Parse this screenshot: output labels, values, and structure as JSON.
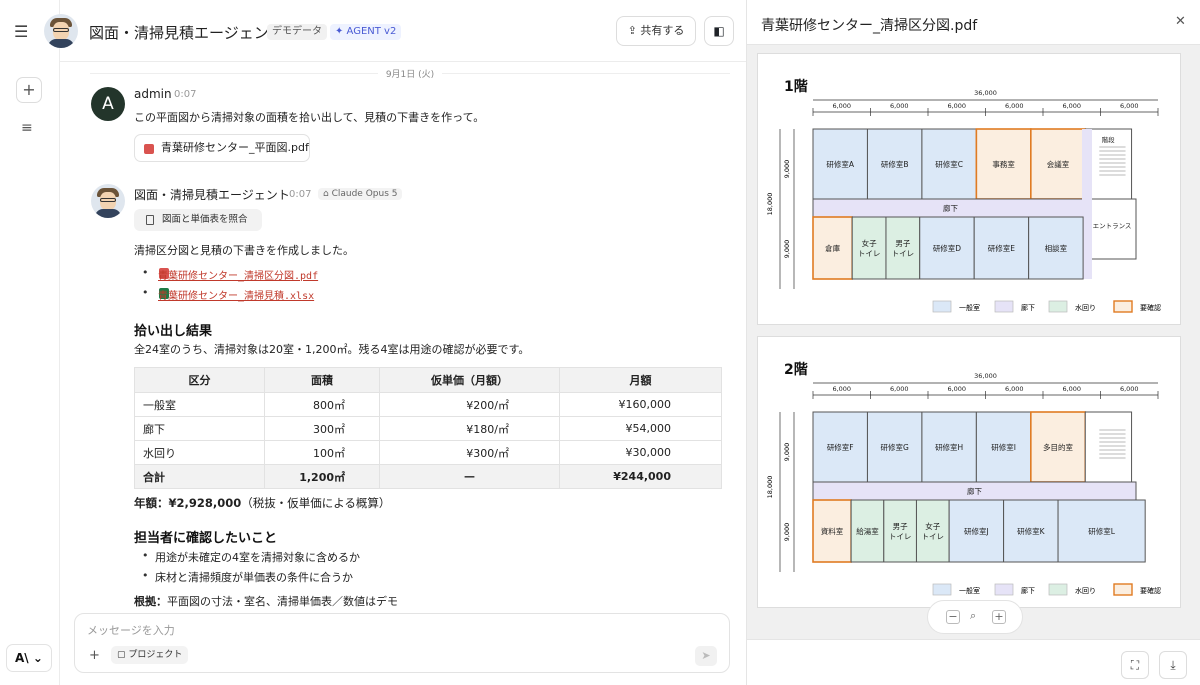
{
  "app": {
    "logo": "A\\ ⌄"
  },
  "header": {
    "title": "図面・清掃見積エージェント",
    "demo_badge": "デモデータ",
    "agent_badge": "✦ AGENT v2",
    "share_label": "共有する"
  },
  "chat": {
    "date": "9月1日 (火)",
    "user": {
      "initial": "A",
      "name": "admin",
      "time": "0:07",
      "text": "この平面図から清掃対象の面積を拾い出して、見積の下書きを作って。",
      "file": "青葉研修センター_平面図.pdf"
    },
    "agent": {
      "name": "図面・清掃見積エージェント",
      "time": "0:07",
      "model": "Claude Opus 5",
      "tool": "図面と単価表を照合",
      "intro": "清掃区分図と見積の下書きを作成しました。",
      "files": [
        "青葉研修センター_清掃区分図.pdf",
        "青葉研修センター_清掃見積.xlsx"
      ],
      "section1": "拾い出し結果",
      "summary": "全24室のうち、清掃対象は20室・1,200㎡。残る4室は用途の確認が必要です。",
      "table": {
        "headers": [
          "区分",
          "面積",
          "仮単価（月額）",
          "月額"
        ],
        "rows": [
          [
            "一般室",
            "800㎡",
            "¥200/㎡",
            "¥160,000"
          ],
          [
            "廊下",
            "300㎡",
            "¥180/㎡",
            "¥54,000"
          ],
          [
            "水回り",
            "100㎡",
            "¥300/㎡",
            "¥30,000"
          ]
        ],
        "total": [
          "合計",
          "1,200㎡",
          "—",
          "¥244,000"
        ]
      },
      "annual_label": "年額：",
      "annual_value": "¥2,928,000",
      "annual_note": "（税抜・仮単価による概算）",
      "section2": "担当者に確認したいこと",
      "questions": [
        "用途が未確定の4室を清掃対象に含めるか",
        "床材と清掃頻度が単価表の条件に合うか"
      ],
      "basis_label": "根拠：",
      "basis_text": "平面図の寸法・室名、清掃単価表／数値はデモ"
    }
  },
  "input": {
    "placeholder": "メッセージを入力",
    "project_label": "プロジェクト"
  },
  "side": {
    "title": "青葉研修センター_清掃区分図.pdf",
    "floor1": {
      "label": "1階",
      "total": "36,000",
      "spans": [
        "6,000",
        "6,000",
        "6,000",
        "6,000",
        "6,000",
        "6,000"
      ],
      "height": "18,000",
      "half": "9,000",
      "top_rooms": [
        "研修室A",
        "研修室B",
        "研修室C",
        "事務室",
        "会議室"
      ],
      "stairs": "階段",
      "corridor": "廊下",
      "entrance": "エントランス",
      "bottom_rooms": [
        "倉庫",
        "女子\nトイレ",
        "男子\nトイレ",
        "研修室D",
        "研修室E",
        "相談室"
      ]
    },
    "floor2": {
      "label": "2階",
      "total": "36,000",
      "spans": [
        "6,000",
        "6,000",
        "6,000",
        "6,000",
        "6,000",
        "6,000"
      ],
      "height": "18,000",
      "half": "9,000",
      "top_rooms": [
        "研修室F",
        "研修室G",
        "研修室H",
        "研修室I",
        "多目的室"
      ],
      "corridor": "廊下",
      "bottom_rooms": [
        "資料室",
        "給湯室",
        "男子\nトイレ",
        "女子\nトイレ",
        "研修室J",
        "研修室K",
        "研修室L"
      ]
    },
    "legend": [
      "一般室",
      "廊下",
      "水回り",
      "要確認"
    ]
  },
  "colors": {
    "general": "#dbe8f7",
    "corridor": "#e6e3f7",
    "water": "#dcefe3",
    "check": "#fbeee0",
    "check_border": "#e07b22"
  }
}
